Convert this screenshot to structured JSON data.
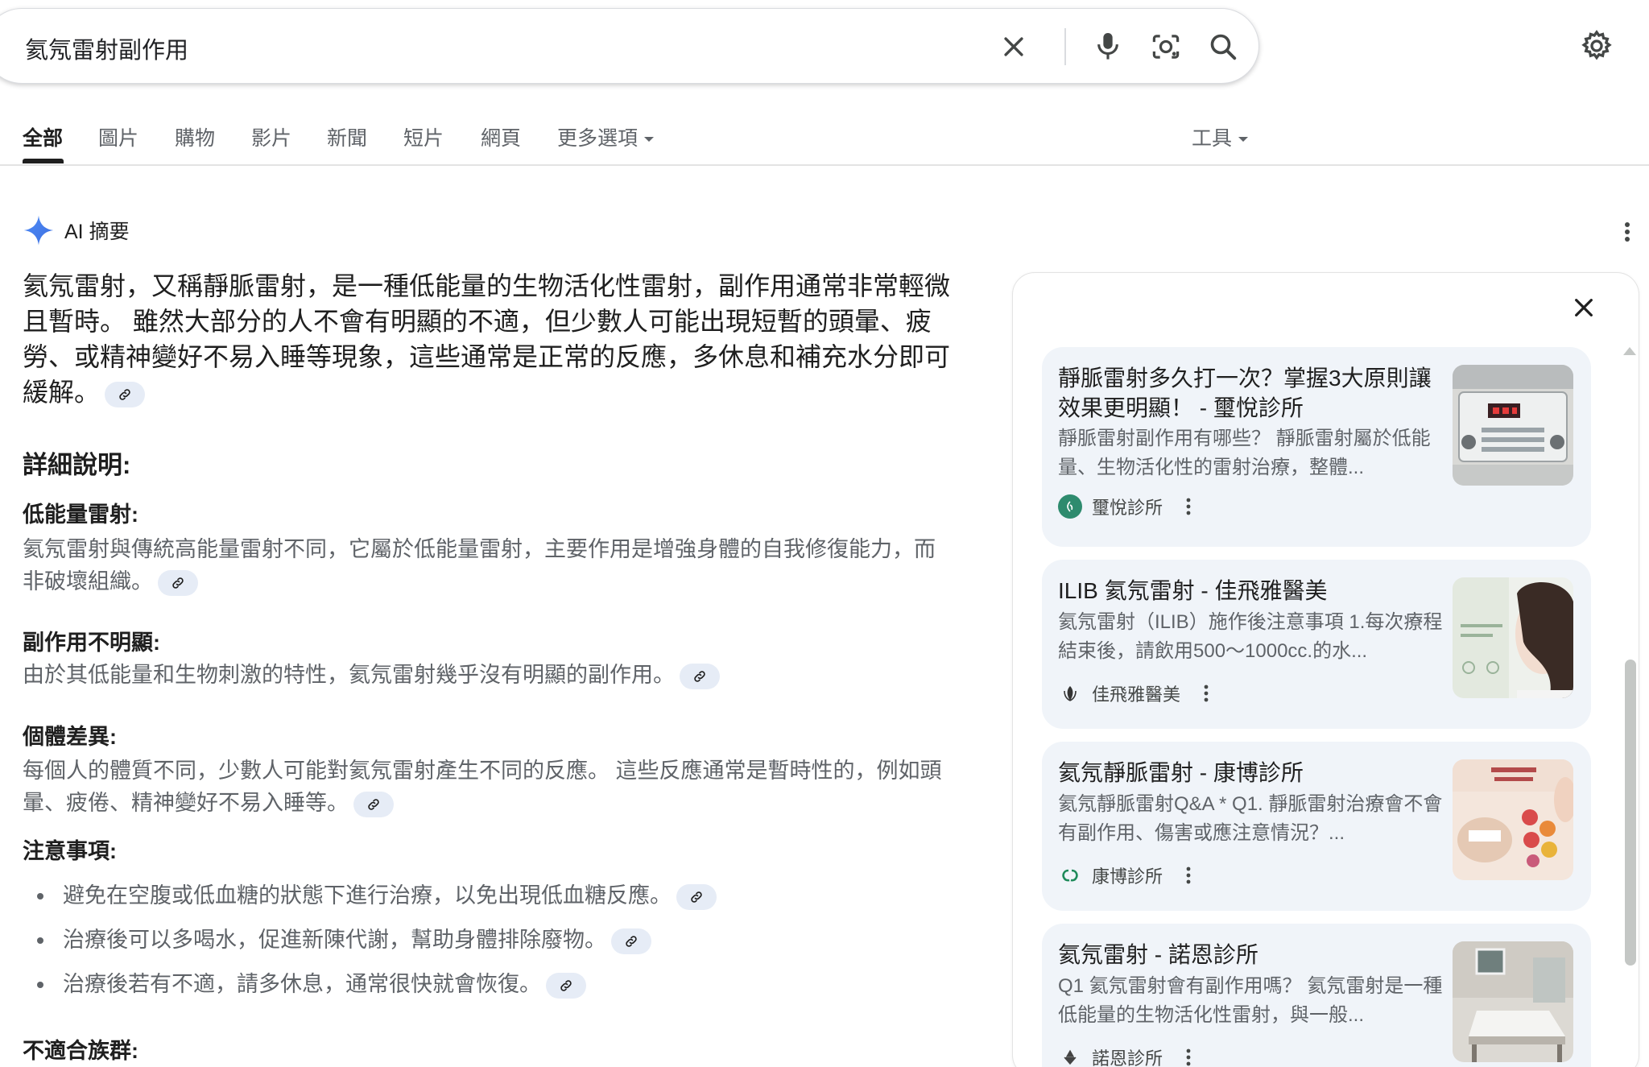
{
  "search": {
    "query": "氦氖雷射副作用",
    "icons": [
      "close-icon",
      "mic-icon",
      "lens-icon",
      "search-icon"
    ]
  },
  "settings_icon": "gear-icon",
  "tabs": [
    {
      "label": "全部",
      "active": true
    },
    {
      "label": "圖片"
    },
    {
      "label": "購物"
    },
    {
      "label": "影片"
    },
    {
      "label": "新聞"
    },
    {
      "label": "短片"
    },
    {
      "label": "網頁"
    },
    {
      "label": "更多選項"
    }
  ],
  "tools_label": "工具",
  "ai_overview": {
    "label": "AI 摘要",
    "summary": "氦氖雷射，又稱靜脈雷射，是一種低能量的生物活化性雷射，副作用通常非常輕微且暫時。 雖然大部分的人不會有明顯的不適，但少數人可能出現短暫的頭暈、疲勞、或精神變好不易入睡等現象，這些通常是正常的反應，多休息和補充水分即可緩解。",
    "details_title": "詳細說明:",
    "sections": [
      {
        "title": "低能量雷射:",
        "body": "氦氖雷射與傳統高能量雷射不同，它屬於低能量雷射，主要作用是增強身體的自我修復能力，而非破壞組織。"
      },
      {
        "title": "副作用不明顯:",
        "body": "由於其低能量和生物刺激的特性，氦氖雷射幾乎沒有明顯的副作用。"
      },
      {
        "title": "個體差異:",
        "body": "每個人的體質不同，少數人可能對氦氖雷射產生不同的反應。 這些反應通常是暫時性的，例如頭暈、疲倦、精神變好不易入睡等。"
      }
    ],
    "precautions_title": "注意事項:",
    "precautions": [
      "避免在空腹或低血糖的狀態下進行治療，以免出現低血糖反應。",
      "治療後可以多喝水，促進新陳代謝，幫助身體排除廢物。",
      "治療後若有不適，請多休息，通常很快就會恢復。"
    ],
    "unsuitable_title": "不適合族群:"
  },
  "sources": [
    {
      "title": "靜脈雷射多久打一次？掌握3大原則讓效果更明顯！ - 璽悅診所",
      "snippet": "靜脈雷射副作用有哪些？ 靜脈雷射屬於低能量、生物活化性的雷射治療，整體...",
      "source": "璽悅診所",
      "favicon_color": "#2e8b6e"
    },
    {
      "title": "ILIB 氦氖雷射 - 佳飛雅醫美",
      "snippet": "氦氖雷射（ILIB）施作後注意事項 1.每次療程結束後，請飲用500～1000cc.的水...",
      "source": "佳飛雅醫美",
      "favicon_color": "#333333"
    },
    {
      "title": "氦氖靜脈雷射 - 康博診所",
      "snippet": "氦氖靜脈雷射Q&A * Q1. 靜脈雷射治療會不會有副作用、傷害或應注意情況？...",
      "source": "康博診所",
      "favicon_color": "#1e8a5a"
    },
    {
      "title": "氦氖雷射 - 諾恩診所",
      "snippet": "Q1 氦氖雷射會有副作用嗎？ 氦氖雷射是一種低能量的生物活化性雷射，與一般...",
      "source": "諾恩診所",
      "favicon_color": "#444444"
    }
  ]
}
